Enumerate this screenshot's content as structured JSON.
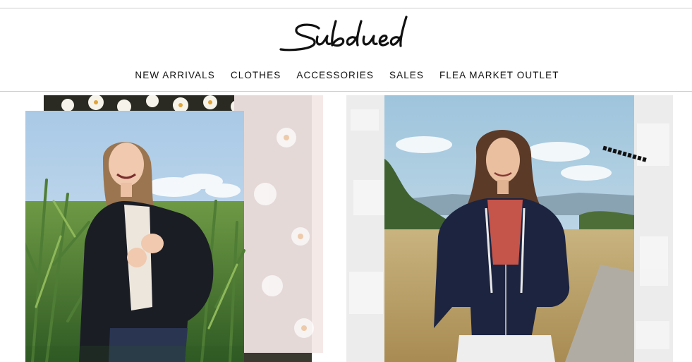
{
  "brand": {
    "name": "Subdued",
    "logo_icon": "subdued-script-logo"
  },
  "nav": {
    "items": [
      {
        "label": "NEW ARRIVALS"
      },
      {
        "label": "CLOTHES"
      },
      {
        "label": "ACCESSORIES"
      },
      {
        "label": "SALES"
      },
      {
        "label": "FLEA MARKET OUTLET"
      }
    ]
  },
  "promos": [
    {
      "name": "left-promo-image",
      "description_icon": "woman-in-black-bomber-jacket-cornfield-photo"
    },
    {
      "name": "right-promo-image",
      "description_icon": "woman-in-navy-hoodie-country-road-photo"
    }
  ],
  "colors": {
    "text": "#111111",
    "rule": "#cfcfcf",
    "background": "#ffffff"
  }
}
